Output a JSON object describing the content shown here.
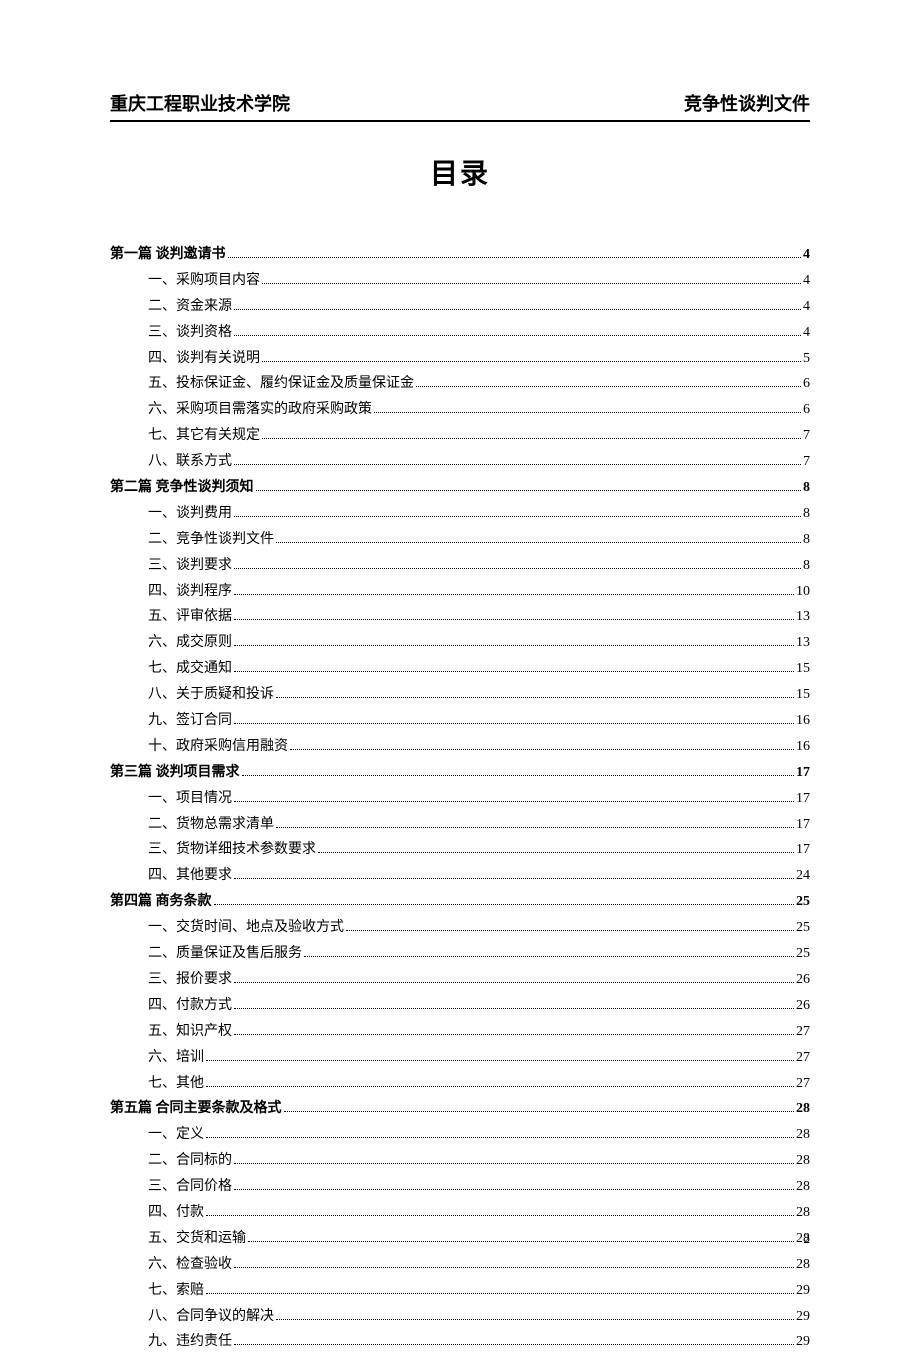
{
  "header": {
    "left": "重庆工程职业技术学院",
    "right": "竞争性谈判文件"
  },
  "title": "目录",
  "page_number": "2",
  "toc": [
    {
      "level": 0,
      "label": "第一篇 谈判邀请书",
      "page": "4"
    },
    {
      "level": 1,
      "label": "一、采购项目内容",
      "page": "4"
    },
    {
      "level": 1,
      "label": "二、资金来源",
      "page": "4"
    },
    {
      "level": 1,
      "label": "三、谈判资格",
      "page": "4"
    },
    {
      "level": 1,
      "label": "四、谈判有关说明",
      "page": "5"
    },
    {
      "level": 1,
      "label": "五、投标保证金、履约保证金及质量保证金",
      "page": "6"
    },
    {
      "level": 1,
      "label": "六、采购项目需落实的政府采购政策",
      "page": "6"
    },
    {
      "level": 1,
      "label": "七、其它有关规定",
      "page": "7"
    },
    {
      "level": 1,
      "label": "八、联系方式",
      "page": "7"
    },
    {
      "level": 0,
      "label": "第二篇 竞争性谈判须知",
      "page": "8"
    },
    {
      "level": 1,
      "label": "一、谈判费用",
      "page": "8"
    },
    {
      "level": 1,
      "label": "二、竞争性谈判文件",
      "page": "8"
    },
    {
      "level": 1,
      "label": "三、谈判要求",
      "page": "8"
    },
    {
      "level": 1,
      "label": "四、谈判程序",
      "page": "10"
    },
    {
      "level": 1,
      "label": "五、评审依据",
      "page": "13"
    },
    {
      "level": 1,
      "label": "六、成交原则",
      "page": "13"
    },
    {
      "level": 1,
      "label": "七、成交通知",
      "page": "15"
    },
    {
      "level": 1,
      "label": "八、关于质疑和投诉",
      "page": "15"
    },
    {
      "level": 1,
      "label": "九、签订合同",
      "page": "16"
    },
    {
      "level": 1,
      "label": "十、政府采购信用融资",
      "page": "16"
    },
    {
      "level": 0,
      "label": "第三篇   谈判项目需求",
      "page": "17"
    },
    {
      "level": 1,
      "label": "一、项目情况",
      "page": "17"
    },
    {
      "level": 1,
      "label": "二、货物总需求清单",
      "page": "17"
    },
    {
      "level": 1,
      "label": "三、货物详细技术参数要求",
      "page": "17"
    },
    {
      "level": 1,
      "label": "四、其他要求",
      "page": "24"
    },
    {
      "level": 0,
      "label": "第四篇   商务条款",
      "page": "25"
    },
    {
      "level": 1,
      "label": "一、交货时间、地点及验收方式",
      "page": "25"
    },
    {
      "level": 1,
      "label": "二、质量保证及售后服务",
      "page": "25"
    },
    {
      "level": 1,
      "label": "三、报价要求",
      "page": "26"
    },
    {
      "level": 1,
      "label": "四、付款方式",
      "page": "26"
    },
    {
      "level": 1,
      "label": "五、知识产权",
      "page": "27"
    },
    {
      "level": 1,
      "label": "六、培训",
      "page": "27"
    },
    {
      "level": 1,
      "label": "七、其他",
      "page": "27"
    },
    {
      "level": 0,
      "label": "第五篇   合同主要条款及格式",
      "page": "28"
    },
    {
      "level": 1,
      "label": "一、定义",
      "page": "28"
    },
    {
      "level": 1,
      "label": "二、合同标的",
      "page": "28"
    },
    {
      "level": 1,
      "label": "三、合同价格",
      "page": "28"
    },
    {
      "level": 1,
      "label": "四、付款",
      "page": "28"
    },
    {
      "level": 1,
      "label": "五、交货和运输",
      "page": "28"
    },
    {
      "level": 1,
      "label": "六、检查验收",
      "page": "28"
    },
    {
      "level": 1,
      "label": "七、索赔",
      "page": "29"
    },
    {
      "level": 1,
      "label": "八、合同争议的解决",
      "page": "29"
    },
    {
      "level": 1,
      "label": "九、违约责任",
      "page": "29"
    }
  ]
}
